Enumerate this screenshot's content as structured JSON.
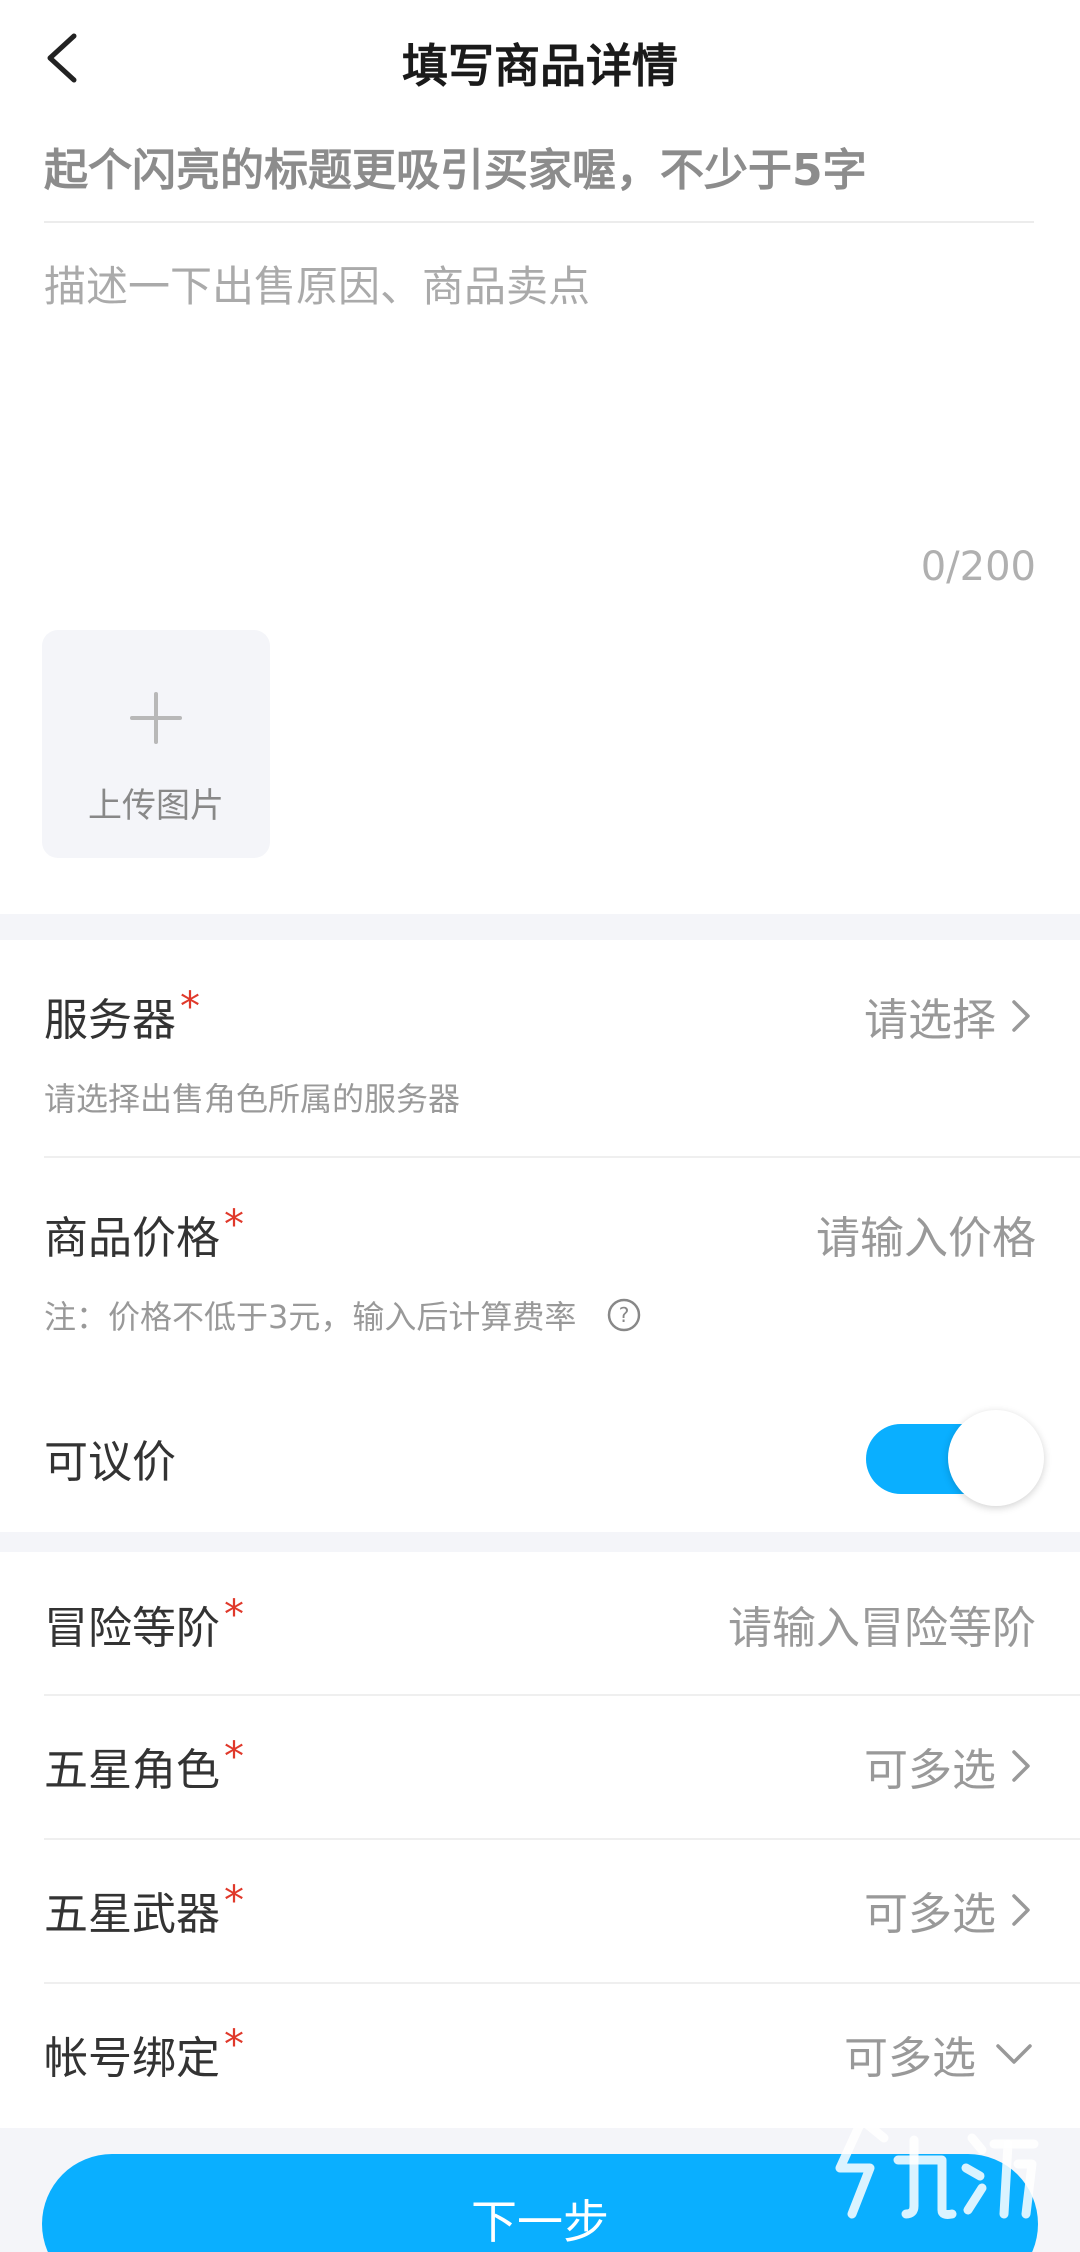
{
  "header": {
    "title": "填写商品详情"
  },
  "title_field": {
    "placeholder": "起个闪亮的标题更吸引买家喔，不少于5字",
    "value": ""
  },
  "description_field": {
    "placeholder": "描述一下出售原因、商品卖点",
    "value": "",
    "char_count": "0/200"
  },
  "upload": {
    "label": "上传图片",
    "icon": "plus-icon"
  },
  "server": {
    "label": "服务器",
    "required_mark": "*",
    "value": "请选择",
    "hint": "请选择出售角色所属的服务器"
  },
  "price": {
    "label": "商品价格",
    "required_mark": "*",
    "placeholder": "请输入价格",
    "hint": "注：价格不低于3元，输入后计算费率"
  },
  "negotiable": {
    "label": "可议价",
    "enabled": true
  },
  "adventure_rank": {
    "label": "冒险等阶",
    "required_mark": "*",
    "placeholder": "请输入冒险等阶"
  },
  "five_star_characters": {
    "label": "五星角色",
    "required_mark": "*",
    "value": "可多选"
  },
  "five_star_weapons": {
    "label": "五星武器",
    "required_mark": "*",
    "value": "可多选"
  },
  "account_binding": {
    "label": "帐号绑定",
    "required_mark": "*",
    "value": "可多选"
  },
  "next_button": {
    "label": "下一步"
  },
  "colors": {
    "accent": "#0aafff",
    "required": "#e0392b",
    "background": "#f4f5f9"
  }
}
